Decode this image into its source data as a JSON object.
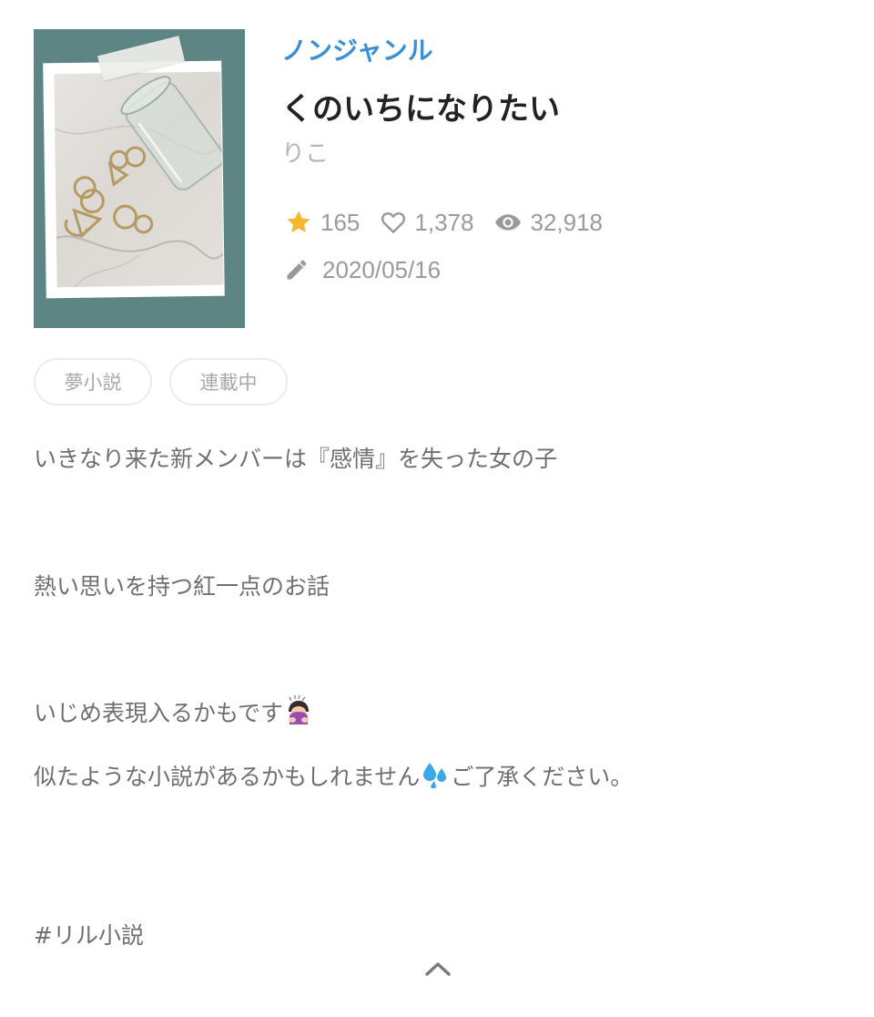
{
  "novel": {
    "genre": "ノンジャンル",
    "title": "くのいちになりたい",
    "author": "りこ",
    "stats": {
      "stars": "165",
      "likes": "1,378",
      "views": "32,918"
    },
    "updated": "2020/05/16",
    "tags": [
      "夢小説",
      "連載中"
    ],
    "description": {
      "line1": "いきなり来た新メンバーは『感情』を失った女の子",
      "line2": "熱い思いを持つ紅一点のお話",
      "line3": "いじめ表現入るかもです",
      "line4_a": "似たような小説があるかもしれません",
      "line4_b": "ご了承ください。",
      "hashtag": "#リル小説"
    }
  },
  "icons": {
    "star": "star-icon",
    "like": "heart-icon",
    "view": "eye-icon",
    "update": "pencil-icon",
    "emoji1": "person-bowing-emoji",
    "emoji2": "sweat-droplets-emoji",
    "collapse": "chevron-up-icon"
  },
  "colors": {
    "genre": "#3b8fd8",
    "star": "#f5b82e",
    "cover_bg": "#5c8583",
    "muted": "#9a9a9a"
  }
}
